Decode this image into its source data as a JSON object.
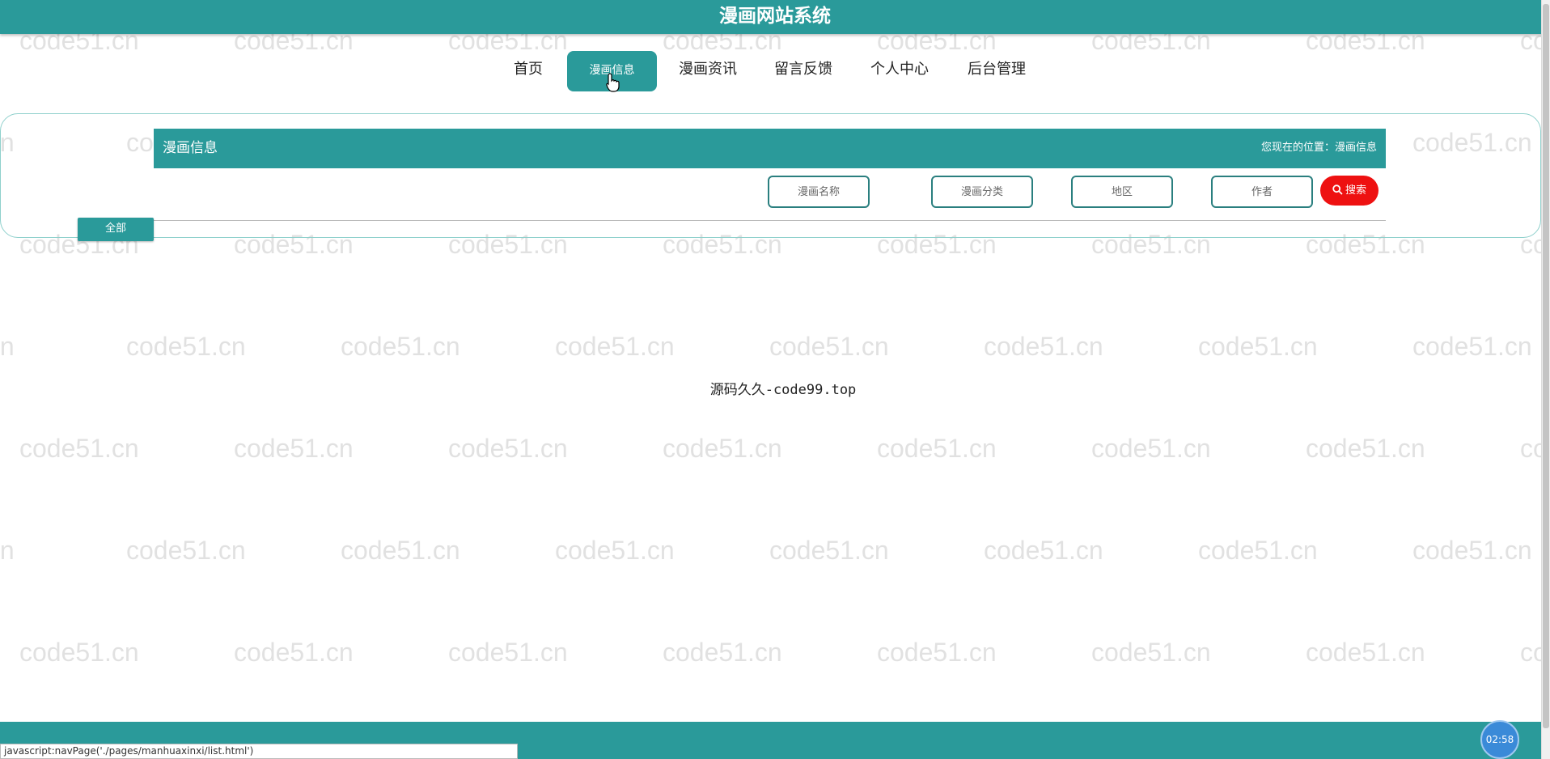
{
  "header": {
    "title": "漫画网站系统"
  },
  "nav": {
    "items": [
      {
        "label": "首页"
      },
      {
        "label": "漫画信息"
      },
      {
        "label": "漫画资讯"
      },
      {
        "label": "留言反馈"
      },
      {
        "label": "个人中心"
      },
      {
        "label": "后台管理"
      }
    ],
    "active_index": 1
  },
  "section": {
    "title": "漫画信息",
    "breadcrumb": "您现在的位置：漫画信息"
  },
  "search": {
    "name_placeholder": "漫画名称",
    "category_placeholder": "漫画分类",
    "region_placeholder": "地区",
    "author_placeholder": "作者",
    "button_label": "搜索"
  },
  "filter": {
    "all_label": "全部"
  },
  "center_text": "源码久久-code99.top",
  "watermark_text": "code51.cn",
  "statusbar": {
    "url": "javascript:navPage('./pages/manhuaxinxi/list.html')"
  },
  "timer": {
    "label": "02:58"
  },
  "colors": {
    "primary": "#2a9a9a",
    "search_button": "#ee1111"
  }
}
